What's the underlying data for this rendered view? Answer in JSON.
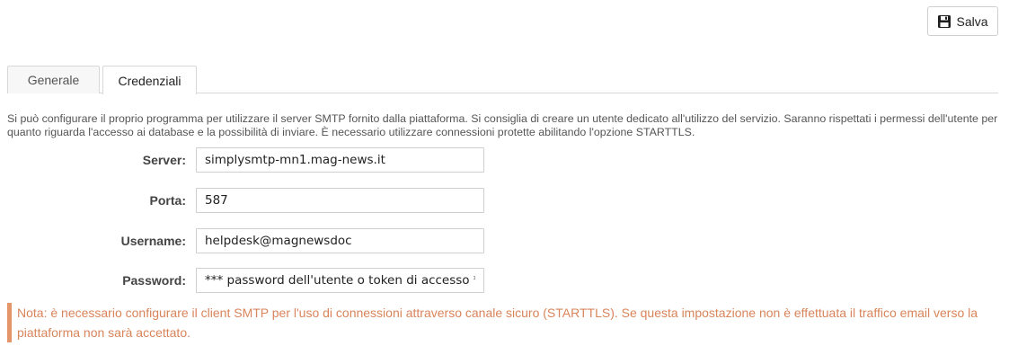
{
  "toolbar": {
    "save_label": "Salva",
    "save_icon": "floppy-disk-icon"
  },
  "tabs": [
    {
      "label": "Generale",
      "active": false
    },
    {
      "label": "Credenziali",
      "active": true
    }
  ],
  "description": "Si può configurare il proprio programma per utilizzare il server SMTP fornito dalla piattaforma. Si consiglia di creare un utente dedicato all'utilizzo del servizio. Saranno rispettati i permessi dell'utente per quanto riguarda l'accesso ai database e la possibilità di inviare. È necessario utilizzare connessioni protette abilitando l'opzione STARTTLS.",
  "form": {
    "server": {
      "label": "Server:",
      "value": "simplysmtp-mn1.mag-news.it"
    },
    "port": {
      "label": "Porta:",
      "value": "587"
    },
    "username": {
      "label": "Username:",
      "value": "helpdesk@magnewsdoc"
    },
    "password": {
      "label": "Password:",
      "value": "*** password dell'utente o token di accesso ***"
    }
  },
  "note": "Nota: è necessario configurare il client SMTP per l'uso di connessioni attraverso canale sicuro (STARTTLS). Se questa impostazione non è effettuata il traffico email verso la piattaforma non sarà accettato.",
  "colors": {
    "note": "#d9845a",
    "note_border": "#e5956a",
    "border": "#cfcfcf"
  }
}
